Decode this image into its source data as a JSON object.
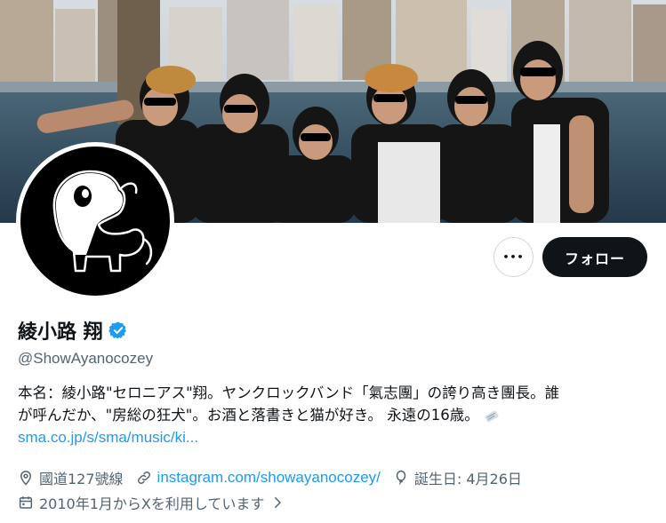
{
  "profile": {
    "display_name": "綾小路 翔",
    "verified": true,
    "handle": "@ShowAyanocozey",
    "bio_line1": "本名：綾小路\"セロニアス\"翔。ヤンクロックバンド「氣志團」の誇り高き團長。誰",
    "bio_line2": "が呼んだか、\"房総の狂犬\"。お酒と落書きと猫が好き。 永遠の16歳。",
    "bio_link": "sma.co.jp/s/sma/music/ki...",
    "location": "國道127號線",
    "website": "instagram.com/showayanocozey/",
    "birthday": "誕生日: 4月26日",
    "joined": "2010年1月からXを利用しています"
  },
  "actions": {
    "more_label": "•••",
    "follow_label": "フォロー"
  },
  "colors": {
    "accent": "#1d9bf0",
    "text": "#0f1419",
    "muted": "#536471",
    "follow_bg": "#0f1419"
  },
  "icons": [
    "verified-badge-icon",
    "location-pin-icon",
    "link-icon",
    "balloon-icon",
    "calendar-icon",
    "chevron-right-icon",
    "more-dots-icon"
  ]
}
